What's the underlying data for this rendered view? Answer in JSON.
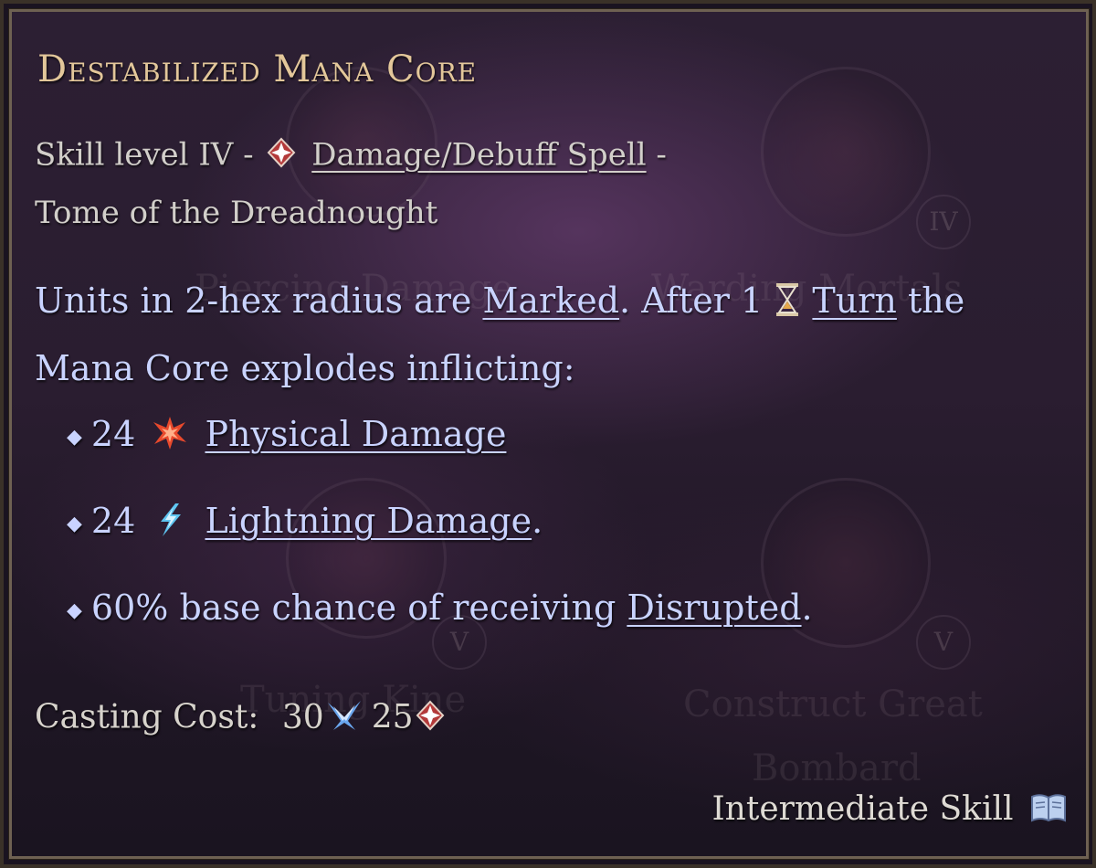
{
  "tooltip": {
    "title": "Destabilized Mana Core",
    "skill_level_text": "Skill level IV -",
    "spell_type_link": "Damage/Debuff Spell",
    "spell_type_suffix": "-",
    "tome": "Tome of the Dreadnought",
    "description": {
      "line1_a": "Units in 2-hex radius are",
      "marked_link": "Marked",
      "line1_b": ". After 1",
      "turn_link": "Turn",
      "line1_c": "the",
      "line2": "Mana Core explodes inflicting:"
    },
    "effects": [
      {
        "amount": "24",
        "icon": "physical-damage-icon",
        "link": "Physical Damage",
        "suffix": ""
      },
      {
        "amount": "24",
        "icon": "lightning-damage-icon",
        "link": "Lightning Damage",
        "suffix": "."
      },
      {
        "text": "60% base chance of receiving",
        "link": "Disrupted",
        "suffix": "."
      }
    ],
    "casting_cost": {
      "label": "Casting Cost:",
      "mana_value": "30",
      "mana_icon": "mana-icon",
      "spell_points_value": "25",
      "spell_points_icon": "spell-points-icon"
    },
    "skill_tier": "Intermediate Skill",
    "skill_tier_icon": "tome-book-icon"
  },
  "background_tree": {
    "node_v_labels": [
      "IV",
      "V",
      "V"
    ],
    "faded_labels": [
      "Piercing Damage",
      "Warding Mortals",
      "Tuning Kine",
      "Construct Great",
      "Bombard"
    ]
  },
  "colors": {
    "title": "#e3c79a",
    "body_text": "#c9d3ff",
    "meta_text": "#d2cfca",
    "border": "#6e6152"
  }
}
